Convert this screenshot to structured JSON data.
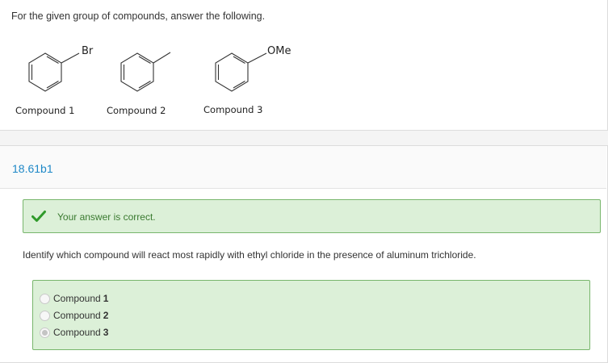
{
  "question": {
    "prompt": "For the given group of compounds, answer the following.",
    "compounds": [
      {
        "label": "Compound 1",
        "substituent": "Br"
      },
      {
        "label": "Compound 2",
        "substituent": ""
      },
      {
        "label": "Compound 3",
        "substituent": "OMe"
      }
    ]
  },
  "part": {
    "id": "18.61b1",
    "feedback": {
      "text": "Your answer is correct.",
      "icon": "check-icon",
      "color": "#3a7a30"
    },
    "instruction": "Identify which compound will react most rapidly with ethyl chloride in the presence of aluminum trichloride.",
    "choices": [
      {
        "word": "Compound",
        "num": "1",
        "selected": false
      },
      {
        "word": "Compound",
        "num": "2",
        "selected": false
      },
      {
        "word": "Compound",
        "num": "3",
        "selected": true
      }
    ]
  },
  "colors": {
    "link": "#1e88c7",
    "success_bg": "#dcf0d8",
    "success_border": "#78b66c"
  }
}
